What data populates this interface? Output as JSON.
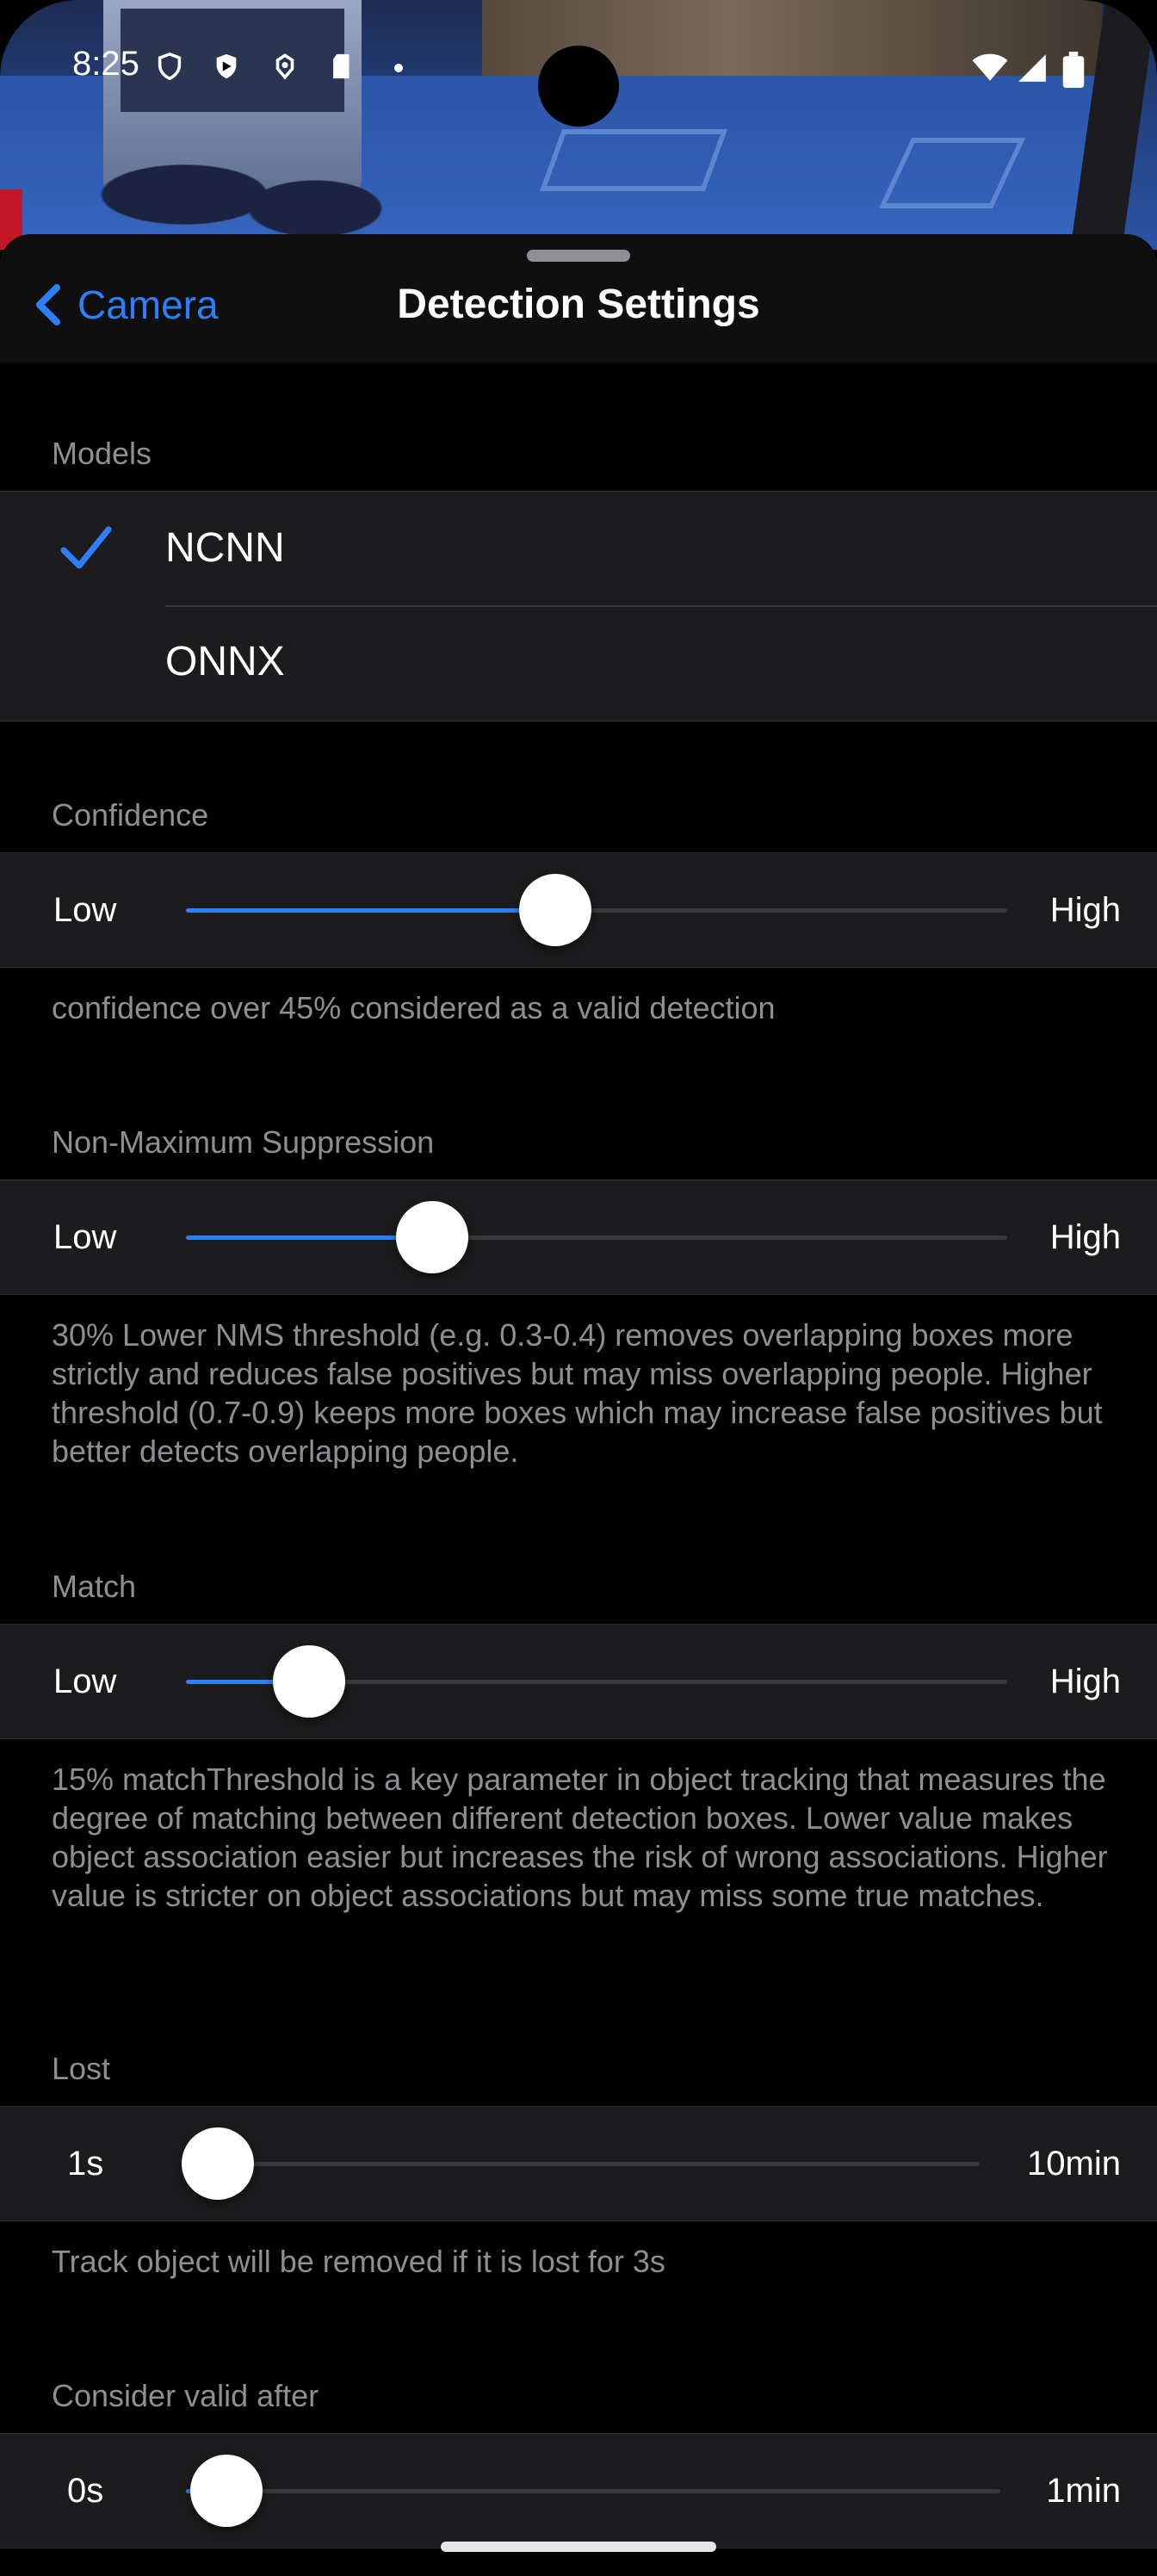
{
  "status_bar": {
    "time": "8:25",
    "icons_left": [
      "vpn-shield-icon",
      "shield-icon",
      "location-icon",
      "sd-card-icon",
      "notification-dot"
    ],
    "icons_right": [
      "wifi-icon",
      "cell-signal-icon",
      "battery-icon"
    ]
  },
  "nav": {
    "back_label": "Camera",
    "title": "Detection Settings"
  },
  "models": {
    "header": "Models",
    "items": [
      {
        "label": "NCNN",
        "selected": true
      },
      {
        "label": "ONNX",
        "selected": false
      }
    ]
  },
  "confidence": {
    "header": "Confidence",
    "min_label": "Low",
    "max_label": "High",
    "value_percent": 45,
    "footer": "confidence over 45% considered as a valid detection"
  },
  "nms": {
    "header": "Non-Maximum Suppression",
    "min_label": "Low",
    "max_label": "High",
    "value_percent": 30,
    "footer": "30% Lower NMS threshold (e.g. 0.3-0.4) removes overlapping boxes more strictly and reduces false positives but may miss overlapping people. Higher threshold (0.7-0.9) keeps more boxes which may increase false positives but better detects overlapping people."
  },
  "match": {
    "header": "Match",
    "min_label": "Low",
    "max_label": "High",
    "value_percent": 15,
    "footer": "15% matchThreshold is a key parameter in object tracking that measures the degree of matching between different detection boxes. Lower value makes object association easier but increases the risk of wrong associations. Higher value is stricter on object associations but may miss some true matches."
  },
  "lost": {
    "header": "Lost",
    "min_label": "1s",
    "max_label": "10min",
    "value_percent": 4,
    "footer": "Track object will be removed if it is lost for 3s"
  },
  "consider_valid": {
    "header": "Consider valid after",
    "min_label": "0s",
    "max_label": "1min",
    "value_percent": 5
  },
  "colors": {
    "accent": "#2d7ff9",
    "group_bg": "#1c1c1e",
    "secondary_text": "#8e8e93"
  }
}
